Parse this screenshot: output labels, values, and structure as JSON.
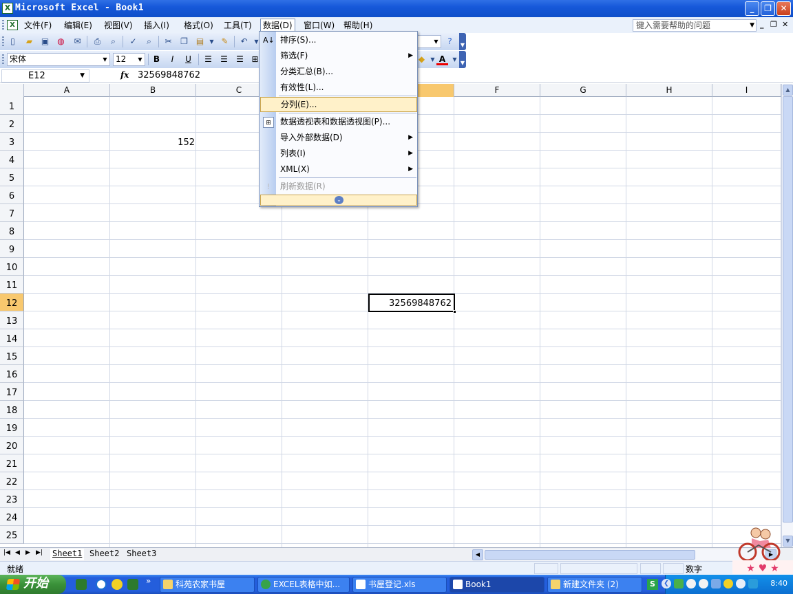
{
  "window": {
    "title": "Microsoft Excel - Book1",
    "minimize": "_",
    "restore": "❐",
    "close": "✕"
  },
  "menubar": {
    "items": [
      "文件(F)",
      "编辑(E)",
      "视图(V)",
      "插入(I)",
      "格式(O)",
      "工具(T)",
      "数据(D)",
      "窗口(W)",
      "帮助(H)"
    ],
    "open_menu": "数据(D)",
    "help_placeholder": "键入需要帮助的问题"
  },
  "toolbar": {
    "font_name": "宋体",
    "font_size": "12",
    "bold": "B",
    "italic": "I",
    "underline": "U"
  },
  "formula_bar": {
    "name_box": "E12",
    "fx_label": "fx",
    "content": "32569848762"
  },
  "grid": {
    "columns": [
      "A",
      "B",
      "C",
      "D",
      "E",
      "F",
      "G",
      "H",
      "I"
    ],
    "selected_column": "E",
    "rows": [
      "1",
      "2",
      "3",
      "4",
      "5",
      "6",
      "7",
      "8",
      "9",
      "10",
      "11",
      "12",
      "13",
      "14",
      "15",
      "16",
      "17",
      "18",
      "19",
      "20",
      "21",
      "22",
      "23",
      "24",
      "25"
    ],
    "selected_row": "12",
    "cells": {
      "B3": "152",
      "E12": "32569848762"
    },
    "active_cell": "E12"
  },
  "data_menu": {
    "items": [
      {
        "label": "排序(S)...",
        "icon": "sort-icon"
      },
      {
        "label": "筛选(F)",
        "submenu": true
      },
      {
        "label": "分类汇总(B)..."
      },
      {
        "label": "有效性(L)..."
      },
      {
        "label": "分列(E)...",
        "highlighted": true
      },
      {
        "label": "数据透视表和数据透视图(P)...",
        "icon": "pivot-table-icon"
      },
      {
        "label": "导入外部数据(D)",
        "submenu": true
      },
      {
        "label": "列表(I)",
        "submenu": true
      },
      {
        "label": "XML(X)",
        "submenu": true
      },
      {
        "label": "刷新数据(R)",
        "disabled": true,
        "icon": "refresh-icon"
      }
    ],
    "expand_icon": "expand-chevron-icon"
  },
  "sheet_tabs": {
    "tabs": [
      "Sheet1",
      "Sheet2",
      "Sheet3"
    ],
    "active": "Sheet1"
  },
  "status": {
    "ready": "就绪",
    "mode": "数字"
  },
  "taskbar": {
    "start": "开始",
    "items": [
      "科苑农家书屋",
      "EXCEL表格中如...",
      "书屋登记.xls",
      "Book1",
      "新建文件夹 (2)"
    ],
    "active_item": "Book1",
    "clock": "8:40"
  },
  "colors": {
    "title_bar": "#1658d9",
    "selected_header": "#f8c86e",
    "menu_highlight": "#fff1c9",
    "taskbar": "#245edc",
    "start_button": "#3a9139"
  }
}
